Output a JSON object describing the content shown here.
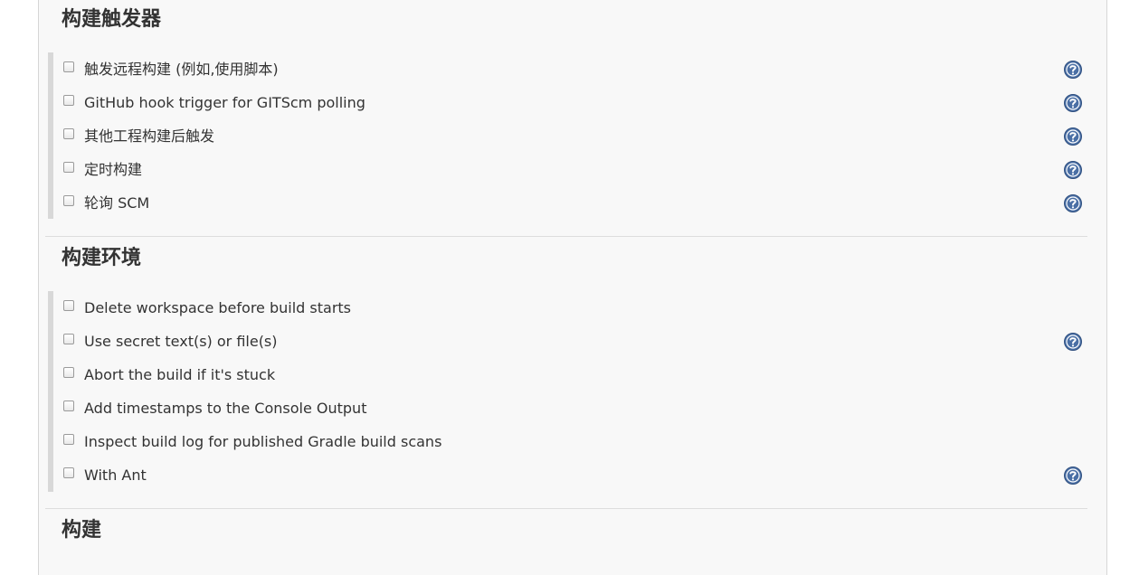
{
  "colors": {
    "panel_background": "#f8f8f8",
    "help_icon": "#4a6fa5",
    "group_bar": "#d8d8d8"
  },
  "sections": {
    "triggers": {
      "title": "构建触发器",
      "items": [
        {
          "label": "触发远程构建 (例如,使用脚本)",
          "checked": false,
          "help_icon": true
        },
        {
          "label": "GitHub hook trigger for GITScm polling",
          "checked": false,
          "help_icon": true
        },
        {
          "label": "其他工程构建后触发",
          "checked": false,
          "help_icon": true
        },
        {
          "label": "定时构建",
          "checked": false,
          "help_icon": true
        },
        {
          "label": "轮询 SCM",
          "checked": false,
          "help_icon": true
        }
      ]
    },
    "environment": {
      "title": "构建环境",
      "items": [
        {
          "label": "Delete workspace before build starts",
          "checked": false,
          "help_icon": false
        },
        {
          "label": "Use secret text(s) or file(s)",
          "checked": false,
          "help_icon": true
        },
        {
          "label": "Abort the build if it's stuck",
          "checked": false,
          "help_icon": false
        },
        {
          "label": "Add timestamps to the Console Output",
          "checked": false,
          "help_icon": false
        },
        {
          "label": "Inspect build log for published Gradle build scans",
          "checked": false,
          "help_icon": false
        },
        {
          "label": "With Ant",
          "checked": false,
          "help_icon": true
        }
      ]
    },
    "build": {
      "title": "构建"
    }
  }
}
